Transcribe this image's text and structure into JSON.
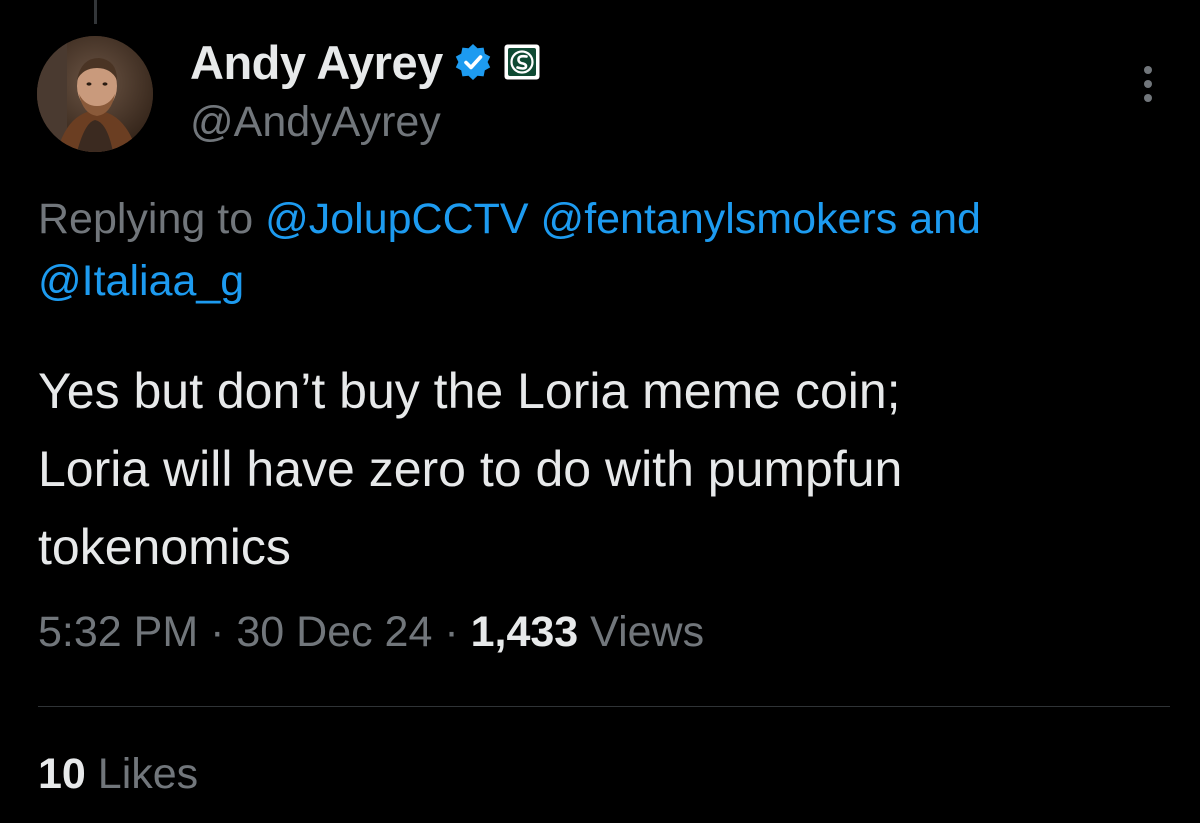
{
  "author": {
    "name": "Andy Ayrey",
    "handle": "@AndyAyrey",
    "verified_icon": "verified-badge-icon",
    "affiliate_icon": "affiliate-badge-icon"
  },
  "reply_context": {
    "prefix": "Replying to ",
    "mentions": [
      "@JolupCCTV",
      "@fentanylsmokers",
      "@Italiaa_g"
    ],
    "joiner": " and"
  },
  "tweet": {
    "lines": [
      "Yes but don’t buy the Loria meme coin;",
      "Loria will have zero to do with pumpfun",
      "tokenomics"
    ]
  },
  "meta": {
    "time": "5:32 PM",
    "separator": " · ",
    "date": "30 Dec 24",
    "views_count": "1,433",
    "views_label": " Views"
  },
  "engagement": {
    "likes_count": "10",
    "likes_label": " Likes"
  },
  "colors": {
    "background": "#000000",
    "primary_text": "#e7e9ea",
    "secondary_text": "#71767b",
    "link": "#1d9bf0",
    "verified": "#1d9bf0"
  }
}
